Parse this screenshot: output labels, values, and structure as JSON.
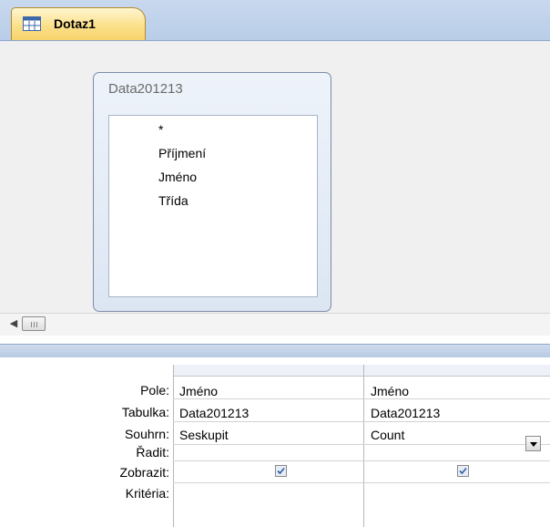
{
  "tab": {
    "label": "Dotaz1",
    "icon": "query-icon"
  },
  "table_window": {
    "title": "Data201213",
    "fields": [
      "*",
      "Příjmení",
      "Jméno",
      "Třída"
    ]
  },
  "grid": {
    "row_labels": {
      "pole": "Pole:",
      "tabulka": "Tabulka:",
      "souhrn": "Souhrn:",
      "radit": "Řadit:",
      "zobrazit": "Zobrazit:",
      "kriteria": "Kritéria:"
    },
    "columns": [
      {
        "pole": "Jméno",
        "tabulka": "Data201213",
        "souhrn": "Seskupit",
        "zobrazit": true
      },
      {
        "pole": "Jméno",
        "tabulka": "Data201213",
        "souhrn": "Count",
        "zobrazit": true
      }
    ]
  },
  "colors": {
    "tab_active": "#f7d36a",
    "strip": "#b9cde8"
  }
}
